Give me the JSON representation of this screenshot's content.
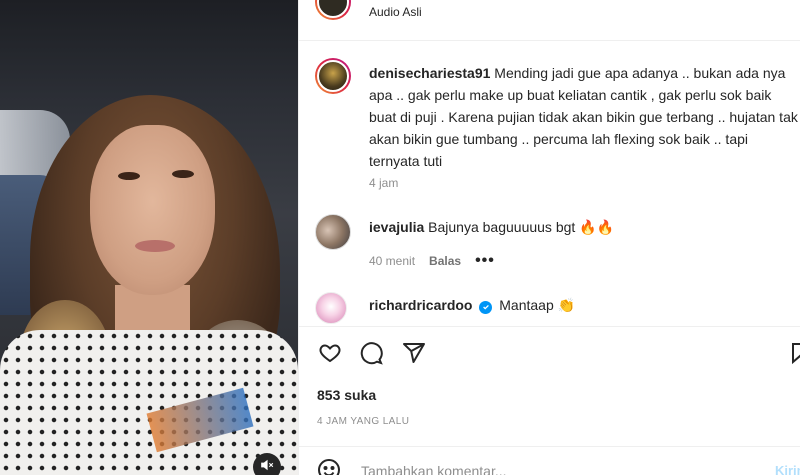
{
  "header": {
    "audio_label": "Audio Asli"
  },
  "caption": {
    "username": "denisechariesta91",
    "text": "Mending jadi gue apa adanya .. bukan ada nya apa .. gak perlu make up buat keliatan cantik , gak perlu sok baik buat di puji . Karena pujian tidak akan bikin gue terbang .. hujatan tak akan bikin gue tumbang .. percuma lah flexing sok baik .. tapi ternyata tuti",
    "time": "4 jam"
  },
  "comments": [
    {
      "username": "ievajulia",
      "text": "Bajunya baguuuuus bgt",
      "emoji": "🔥🔥",
      "time": "40 menit",
      "reply_label": "Balas",
      "more": "•••"
    },
    {
      "username": "richardricardoo",
      "text": "Mantaap",
      "emoji": "👏",
      "verified": true
    }
  ],
  "actions": {
    "icons": [
      "heart-icon",
      "comment-icon",
      "share-icon",
      "bookmark-icon"
    ]
  },
  "likes": "853 suka",
  "posted_time": "4 JAM YANG LALU",
  "add_comment": {
    "placeholder": "Tambahkan komentar...",
    "post_label": "Kirim"
  },
  "colors": {
    "accent": "#0095f6",
    "text": "#262626",
    "muted": "#8e8e8e",
    "story_ring": "#dc2743"
  }
}
